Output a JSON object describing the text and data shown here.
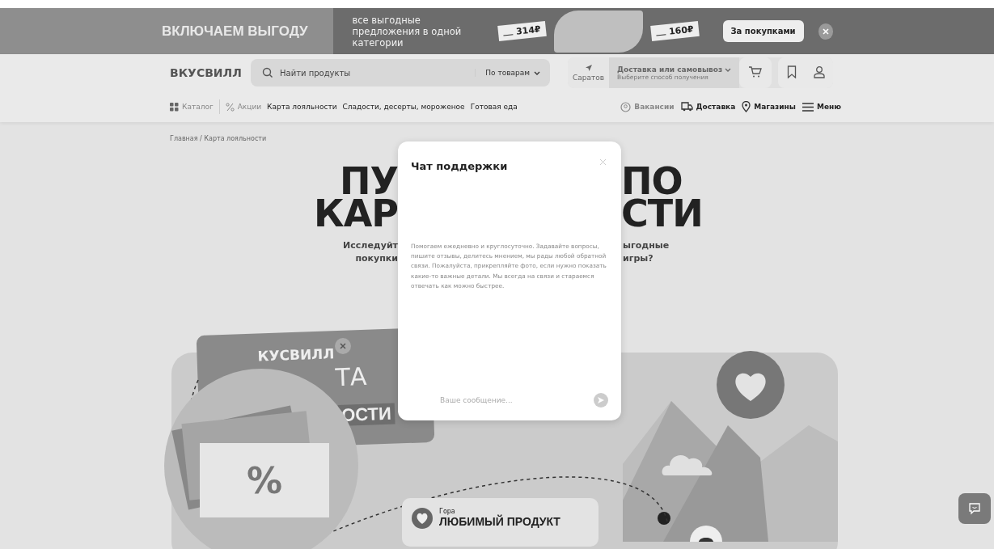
{
  "banner": {
    "title": "ВКЛЮЧАЕМ ВЫГОДУ",
    "text": "все выгодные предложения в одной категории",
    "prices": [
      "314₽",
      "160₽"
    ],
    "button": "За покупками"
  },
  "header": {
    "logo": "ВКУСВИЛЛ",
    "search": {
      "placeholder": "Найти продукты",
      "filter": "По товарам"
    },
    "city": "Саратов",
    "delivery": {
      "title": "Доставка или самовывоз",
      "subtitle": "Выберите способ получения"
    }
  },
  "nav": {
    "left": [
      {
        "label": "Каталог",
        "kind": "catalog",
        "muted": true
      },
      {
        "label": "Акции",
        "kind": "sale",
        "muted": true
      },
      {
        "label": "Карта лояльности",
        "kind": "plain",
        "muted": false
      },
      {
        "label": "Сладости, десерты, мороженое",
        "kind": "plain",
        "muted": false
      },
      {
        "label": "Готовая еда",
        "kind": "plain",
        "muted": false
      }
    ],
    "right": [
      {
        "label": "Вакансии",
        "kind": "jobs",
        "muted": true
      },
      {
        "label": "Доставка",
        "kind": "delivery",
        "muted": false
      },
      {
        "label": "Магазины",
        "kind": "stores",
        "muted": false
      },
      {
        "label": "Меню",
        "kind": "menu",
        "muted": false
      }
    ]
  },
  "breadcrumb": "Главная / Карта лояльности",
  "hero": {
    "title_left": [
      "ПУ",
      "КАР"
    ],
    "title_right": [
      "ПО",
      "СТИ"
    ],
    "subtitle_left": [
      "Исследуйт",
      "покупки"
    ],
    "subtitle_right": [
      "ыгодные",
      "игры?"
    ]
  },
  "illustration": {
    "card_texts": [
      "КУСВИЛЛ",
      "ТА",
      "ОСТИ"
    ],
    "percent": "%",
    "place": {
      "label": "Гора",
      "title": "ЛЮБИМЫЙ ПРОДУКТ"
    }
  },
  "chat": {
    "title": "Чат поддержки",
    "intro": "Помогаем ежедневно и круглосуточно. Задавайте вопросы, пишите отзывы, делитесь мнением, мы рады любой обратной связи. Пожалуйста, прикрепляйте фото, если нужно показать какие-то важные детали. Мы всегда на связи и стараемся отвечать как можно быстрее.",
    "placeholder": "Ваше сообщение..."
  }
}
